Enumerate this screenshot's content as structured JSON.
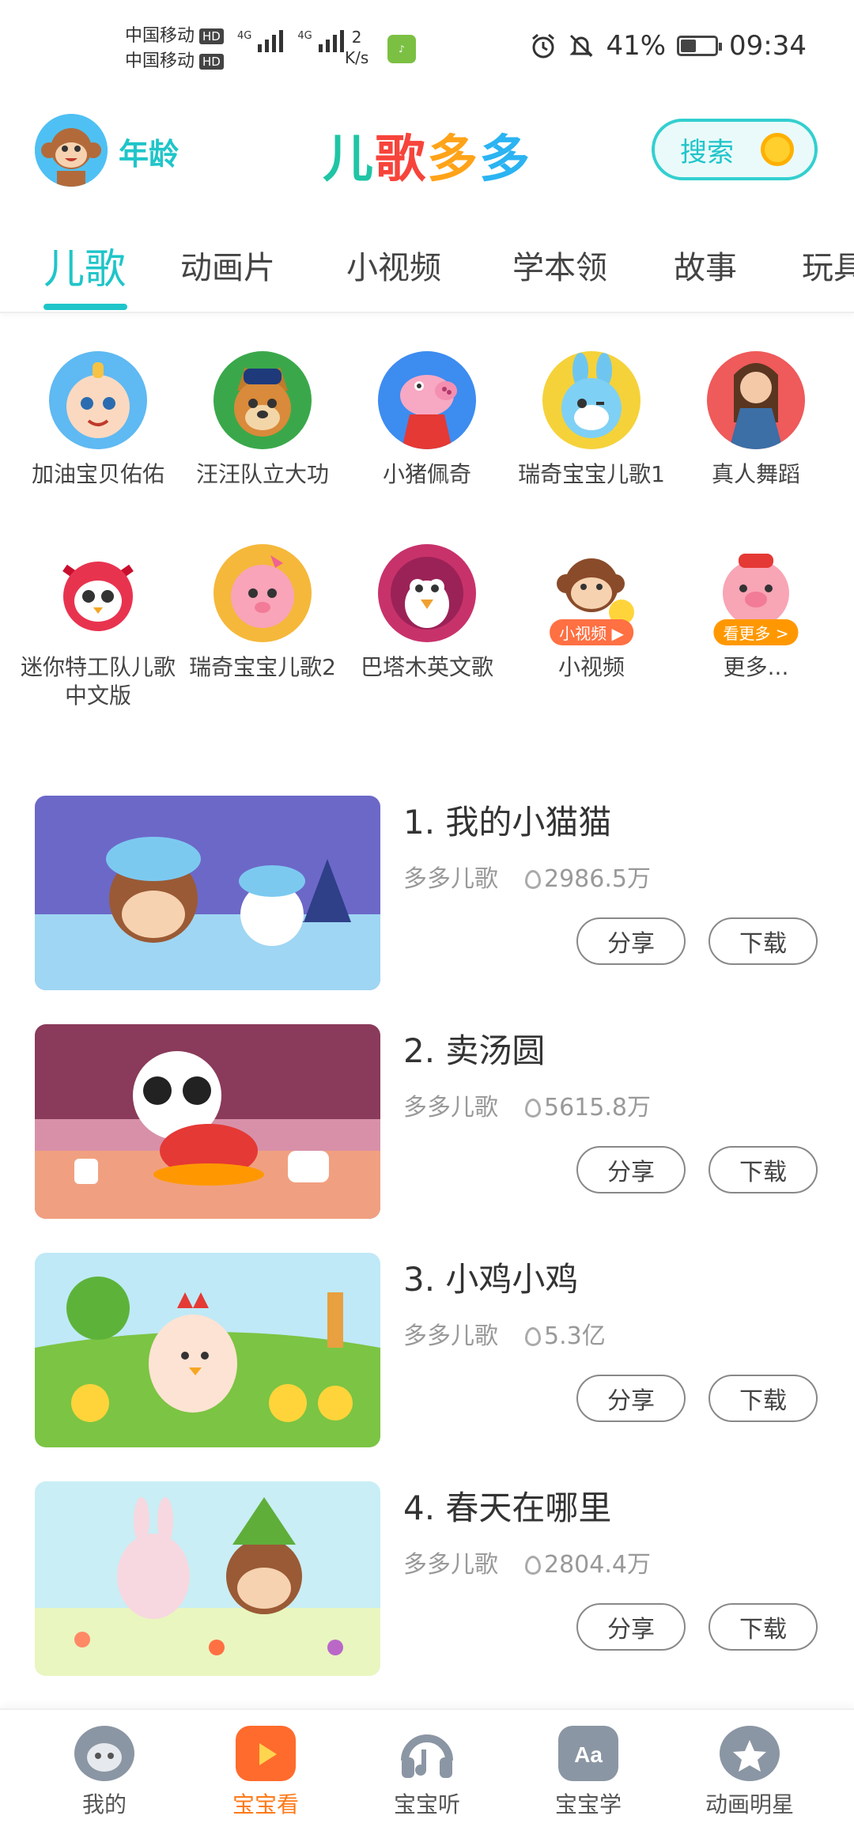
{
  "status_bar": {
    "carrier1": "中国移动",
    "carrier2": "中国移动",
    "hd": "HD",
    "network": "4G",
    "speed_value": "2",
    "speed_unit": "K/s",
    "battery": "41%",
    "battery_level": 0.41,
    "time": "09:34"
  },
  "header": {
    "age_label": "年龄",
    "logo_text": "儿歌多多",
    "search_label": "搜索"
  },
  "tabs": [
    {
      "label": "儿歌",
      "active": true
    },
    {
      "label": "动画片"
    },
    {
      "label": "小视频"
    },
    {
      "label": "学本领"
    },
    {
      "label": "故事"
    },
    {
      "label": "玩具"
    }
  ],
  "categories": [
    {
      "label": "加油宝贝佑佑",
      "color": "#5fb9f2"
    },
    {
      "label": "汪汪队立大功",
      "color": "#3aa84a"
    },
    {
      "label": "小猪佩奇",
      "color": "#3d8cf0"
    },
    {
      "label": "瑞奇宝宝儿歌1",
      "color": "#f5d23a"
    },
    {
      "label": "真人舞蹈",
      "color": "#ef5a5a"
    },
    {
      "label": "迷你特工队儿歌 中文版",
      "color": "#e8334f"
    },
    {
      "label": "瑞奇宝宝儿歌2",
      "color": "#f5b83a"
    },
    {
      "label": "巴塔木英文歌",
      "color": "#c8326b"
    },
    {
      "label": "小视频",
      "color": "#ffffff",
      "badge": "小视频 ▶"
    },
    {
      "label": "更多...",
      "color": "#ffffff",
      "badge": "看更多 >"
    }
  ],
  "songs": [
    {
      "title": "1. 我的小猫猫",
      "source": "多多儿歌",
      "plays": "2986.5万",
      "share": "分享",
      "download": "下载"
    },
    {
      "title": "2. 卖汤圆",
      "source": "多多儿歌",
      "plays": "5615.8万",
      "share": "分享",
      "download": "下载"
    },
    {
      "title": "3. 小鸡小鸡",
      "source": "多多儿歌",
      "plays": "5.3亿",
      "share": "分享",
      "download": "下载"
    },
    {
      "title": "4. 春天在哪里",
      "source": "多多儿歌",
      "plays": "2804.4万",
      "share": "分享",
      "download": "下载"
    }
  ],
  "bottom_nav": [
    {
      "label": "我的",
      "icon": "monkey-face-icon"
    },
    {
      "label": "宝宝看",
      "icon": "tv-play-icon",
      "active": true
    },
    {
      "label": "宝宝听",
      "icon": "headphones-icon"
    },
    {
      "label": "宝宝学",
      "icon": "puzzle-aa-icon"
    },
    {
      "label": "动画明星",
      "icon": "star-bear-icon"
    }
  ],
  "colors": {
    "accent": "#1fc5c9",
    "active_nav": "#ff7a1a"
  }
}
